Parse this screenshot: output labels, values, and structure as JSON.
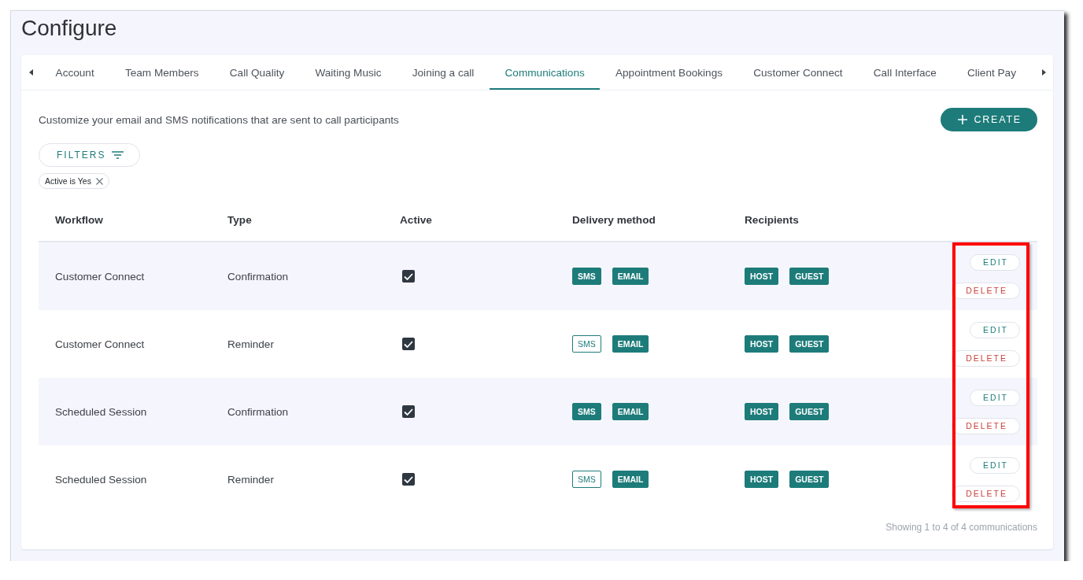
{
  "page": {
    "title": "Configure"
  },
  "tabs": [
    {
      "label": "Account",
      "selected": false
    },
    {
      "label": "Team Members",
      "selected": false
    },
    {
      "label": "Call Quality",
      "selected": false
    },
    {
      "label": "Waiting Music",
      "selected": false
    },
    {
      "label": "Joining a call",
      "selected": false
    },
    {
      "label": "Communications",
      "selected": true
    },
    {
      "label": "Appointment Bookings",
      "selected": false
    },
    {
      "label": "Customer Connect",
      "selected": false
    },
    {
      "label": "Call Interface",
      "selected": false
    },
    {
      "label": "Client Pay",
      "selected": false
    }
  ],
  "description": "Customize your email and SMS notifications that are sent to call participants",
  "create_button": {
    "label": "CREATE"
  },
  "filters_button": {
    "label": "FILTERS"
  },
  "filter_chips": [
    {
      "label": "Active is Yes"
    }
  ],
  "table": {
    "columns": [
      "Workflow",
      "Type",
      "Active",
      "Delivery method",
      "Recipients"
    ],
    "actions_highlighted": true,
    "rows": [
      {
        "workflow": "Customer Connect",
        "type": "Confirmation",
        "active": {
          "checked": true
        },
        "delivery": [
          {
            "label": "SMS",
            "on": true
          },
          {
            "label": "EMAIL",
            "on": true
          }
        ],
        "recipients": [
          {
            "label": "HOST",
            "on": true
          },
          {
            "label": "GUEST",
            "on": true
          }
        ],
        "actions": [
          {
            "label": "EDIT",
            "kind": "edit"
          },
          {
            "label": "DELETE",
            "kind": "delete"
          }
        ]
      },
      {
        "workflow": "Customer Connect",
        "type": "Reminder",
        "active": {
          "checked": true
        },
        "delivery": [
          {
            "label": "SMS",
            "on": false
          },
          {
            "label": "EMAIL",
            "on": true
          }
        ],
        "recipients": [
          {
            "label": "HOST",
            "on": true
          },
          {
            "label": "GUEST",
            "on": true
          }
        ],
        "actions": [
          {
            "label": "EDIT",
            "kind": "edit"
          },
          {
            "label": "DELETE",
            "kind": "delete"
          }
        ]
      },
      {
        "workflow": "Scheduled Session",
        "type": "Confirmation",
        "active": {
          "checked": true
        },
        "delivery": [
          {
            "label": "SMS",
            "on": true
          },
          {
            "label": "EMAIL",
            "on": true
          }
        ],
        "recipients": [
          {
            "label": "HOST",
            "on": true
          },
          {
            "label": "GUEST",
            "on": true
          }
        ],
        "actions": [
          {
            "label": "EDIT",
            "kind": "edit"
          },
          {
            "label": "DELETE",
            "kind": "delete"
          }
        ]
      },
      {
        "workflow": "Scheduled Session",
        "type": "Reminder",
        "active": {
          "checked": true
        },
        "delivery": [
          {
            "label": "SMS",
            "on": false
          },
          {
            "label": "EMAIL",
            "on": true
          }
        ],
        "recipients": [
          {
            "label": "HOST",
            "on": true
          },
          {
            "label": "GUEST",
            "on": true
          }
        ],
        "actions": [
          {
            "label": "EDIT",
            "kind": "edit"
          },
          {
            "label": "DELETE",
            "kind": "delete"
          }
        ]
      }
    ]
  },
  "footer": "Showing 1 to 4 of 4 communications"
}
